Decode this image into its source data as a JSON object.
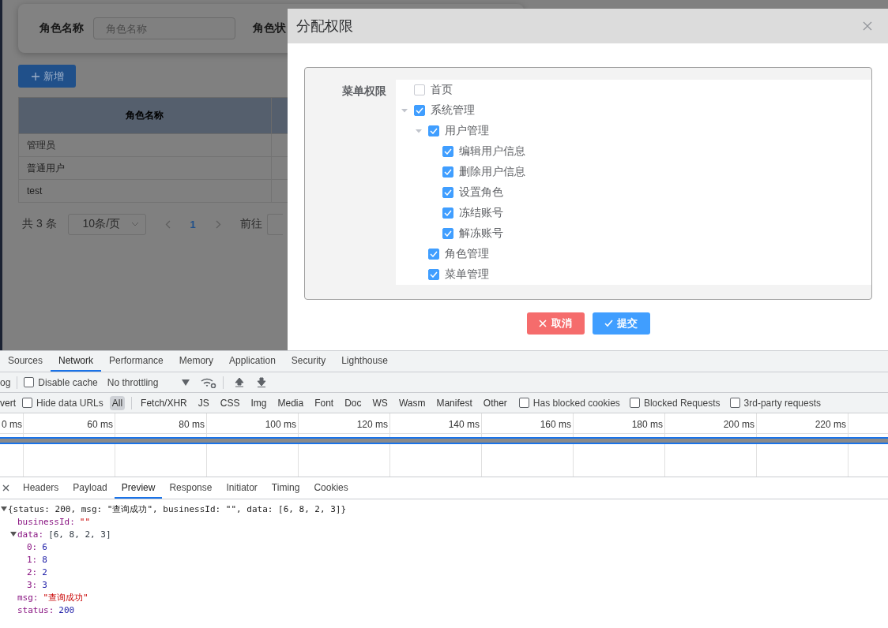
{
  "app": {
    "search_fields": [
      {
        "label": "角色名称",
        "placeholder": "角色名称"
      },
      {
        "label": "角色状"
      }
    ],
    "add_button": {
      "label": "新增"
    },
    "table": {
      "columns": [
        "角色名称"
      ],
      "rows": [
        [
          "管理员"
        ],
        [
          "普通用户"
        ],
        [
          "test"
        ]
      ]
    },
    "pagination": {
      "total": "共 3 条",
      "page_size": "10条/页",
      "pages": [
        {
          "label": "1",
          "selected": true
        }
      ],
      "goto_label": "前往"
    }
  },
  "dialog": {
    "title": "分配权限",
    "form": {
      "label": "菜单权限",
      "tree": [
        {
          "label": "首页",
          "checked": false
        },
        {
          "label": "系统管理",
          "checked": true,
          "expanded": true,
          "children": [
            {
              "label": "用户管理",
              "checked": true,
              "expanded": true,
              "children": [
                {
                  "label": "编辑用户信息",
                  "checked": true
                },
                {
                  "label": "删除用户信息",
                  "checked": true
                },
                {
                  "label": "设置角色",
                  "checked": true
                },
                {
                  "label": "冻结账号",
                  "checked": true
                },
                {
                  "label": "解冻账号",
                  "checked": true
                }
              ]
            },
            {
              "label": "角色管理",
              "checked": true
            },
            {
              "label": "菜单管理",
              "checked": true
            }
          ]
        }
      ]
    },
    "buttons": [
      {
        "kind": "cancel",
        "label": "取消"
      },
      {
        "kind": "submit",
        "label": "提交"
      }
    ]
  },
  "devtools": {
    "tabs": [
      {
        "label": "Sources",
        "selected": false
      },
      {
        "label": "Network",
        "selected": true
      },
      {
        "label": "Performance",
        "selected": false
      },
      {
        "label": "Memory",
        "selected": false
      },
      {
        "label": "Application",
        "selected": false
      },
      {
        "label": "Security",
        "selected": false
      },
      {
        "label": "Lighthouse",
        "selected": false
      }
    ],
    "toolbar": {
      "preserve_log": "og",
      "disable_cache": {
        "label": "Disable cache",
        "checked": false
      },
      "throttling": "No throttling"
    },
    "filter": {
      "invert": "vert",
      "hide_data_urls": {
        "label": "Hide data URLs",
        "checked": false
      },
      "types": [
        {
          "label": "All",
          "selected": true
        },
        {
          "label": "Fetch/XHR",
          "selected": false
        },
        {
          "label": "JS",
          "selected": false
        },
        {
          "label": "CSS",
          "selected": false
        },
        {
          "label": "Img",
          "selected": false
        },
        {
          "label": "Media",
          "selected": false
        },
        {
          "label": "Font",
          "selected": false
        },
        {
          "label": "Doc",
          "selected": false
        },
        {
          "label": "WS",
          "selected": false
        },
        {
          "label": "Wasm",
          "selected": false
        },
        {
          "label": "Manifest",
          "selected": false
        },
        {
          "label": "Other",
          "selected": false
        }
      ],
      "checkboxes": [
        {
          "label": "Has blocked cookies",
          "checked": false
        },
        {
          "label": "Blocked Requests",
          "checked": false
        },
        {
          "label": "3rd-party requests",
          "checked": false
        }
      ]
    },
    "timeline": {
      "ticks": [
        "0 ms",
        "60 ms",
        "80 ms",
        "100 ms",
        "120 ms",
        "140 ms",
        "160 ms",
        "180 ms",
        "200 ms",
        "220 ms"
      ]
    },
    "detail_tabs": [
      {
        "label": "Headers",
        "selected": false
      },
      {
        "label": "Payload",
        "selected": false
      },
      {
        "label": "Preview",
        "selected": true
      },
      {
        "label": "Response",
        "selected": false
      },
      {
        "label": "Initiator",
        "selected": false
      },
      {
        "label": "Timing",
        "selected": false
      },
      {
        "label": "Cookies",
        "selected": false
      }
    ],
    "preview": {
      "summary": "{status: 200, msg: \"查询成功\", businessId: \"\", data: [6, 8, 2, 3]}",
      "expanded": true,
      "properties": [
        {
          "key": "businessId:",
          "value": "\"\"",
          "kind": "string"
        },
        {
          "key": "data:",
          "value": "[6, 8, 2, 3]",
          "kind": "array",
          "expanded": true,
          "children": [
            {
              "key": "0:",
              "value": "6",
              "kind": "number"
            },
            {
              "key": "1:",
              "value": "8",
              "kind": "number"
            },
            {
              "key": "2:",
              "value": "2",
              "kind": "number"
            },
            {
              "key": "3:",
              "value": "3",
              "kind": "number"
            }
          ]
        },
        {
          "key": "msg:",
          "value": "\"查询成功\"",
          "kind": "string"
        },
        {
          "key": "status:",
          "value": "200",
          "kind": "number"
        }
      ]
    }
  }
}
